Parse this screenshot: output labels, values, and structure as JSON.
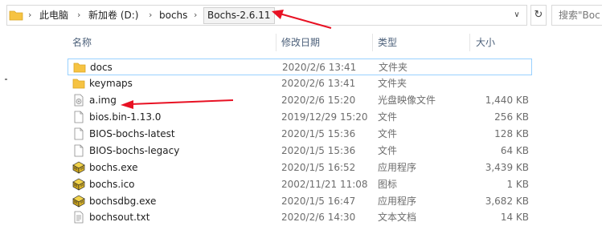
{
  "address": {
    "crumbs": [
      {
        "label": "此电脑"
      },
      {
        "label": "新加卷 (D:)"
      },
      {
        "label": "bochs"
      },
      {
        "label": "Bochs-2.6.11"
      }
    ],
    "dropdown_glyph": "∨"
  },
  "refresh_glyph": "↻",
  "search": {
    "placeholder": "搜索\"Boc"
  },
  "columns": {
    "name": "名称",
    "date": "修改日期",
    "type": "类型",
    "size": "大小"
  },
  "files": [
    {
      "name": "docs",
      "date": "2020/2/6 13:41",
      "type": "文件夹",
      "size": "",
      "icon": "folder-icon"
    },
    {
      "name": "keymaps",
      "date": "2020/2/6 13:41",
      "type": "文件夹",
      "size": "",
      "icon": "folder-icon"
    },
    {
      "name": "a.img",
      "date": "2020/2/6 15:20",
      "type": "光盘映像文件",
      "size": "1,440 KB",
      "icon": "disc-image-icon"
    },
    {
      "name": "bios.bin-1.13.0",
      "date": "2019/12/29 15:20",
      "type": "文件",
      "size": "256 KB",
      "icon": "file-icon"
    },
    {
      "name": "BIOS-bochs-latest",
      "date": "2020/1/5 15:36",
      "type": "文件",
      "size": "128 KB",
      "icon": "file-icon"
    },
    {
      "name": "BIOS-bochs-legacy",
      "date": "2020/1/5 15:36",
      "type": "文件",
      "size": "64 KB",
      "icon": "file-icon"
    },
    {
      "name": "bochs.exe",
      "date": "2020/1/5 16:52",
      "type": "应用程序",
      "size": "3,439 KB",
      "icon": "bochs-app-icon"
    },
    {
      "name": "bochs.ico",
      "date": "2002/11/21 11:08",
      "type": "图标",
      "size": "1 KB",
      "icon": "bochs-app-icon"
    },
    {
      "name": "bochsdbg.exe",
      "date": "2020/1/5 16:47",
      "type": "应用程序",
      "size": "3,682 KB",
      "icon": "bochs-app-icon"
    },
    {
      "name": "bochsout.txt",
      "date": "2020/2/6 14:30",
      "type": "文本文档",
      "size": "14 KB",
      "icon": "text-file-icon"
    }
  ],
  "colors": {
    "arrow": "#e81123",
    "selection_border": "#99d1ff",
    "folder": "#f6c342"
  }
}
